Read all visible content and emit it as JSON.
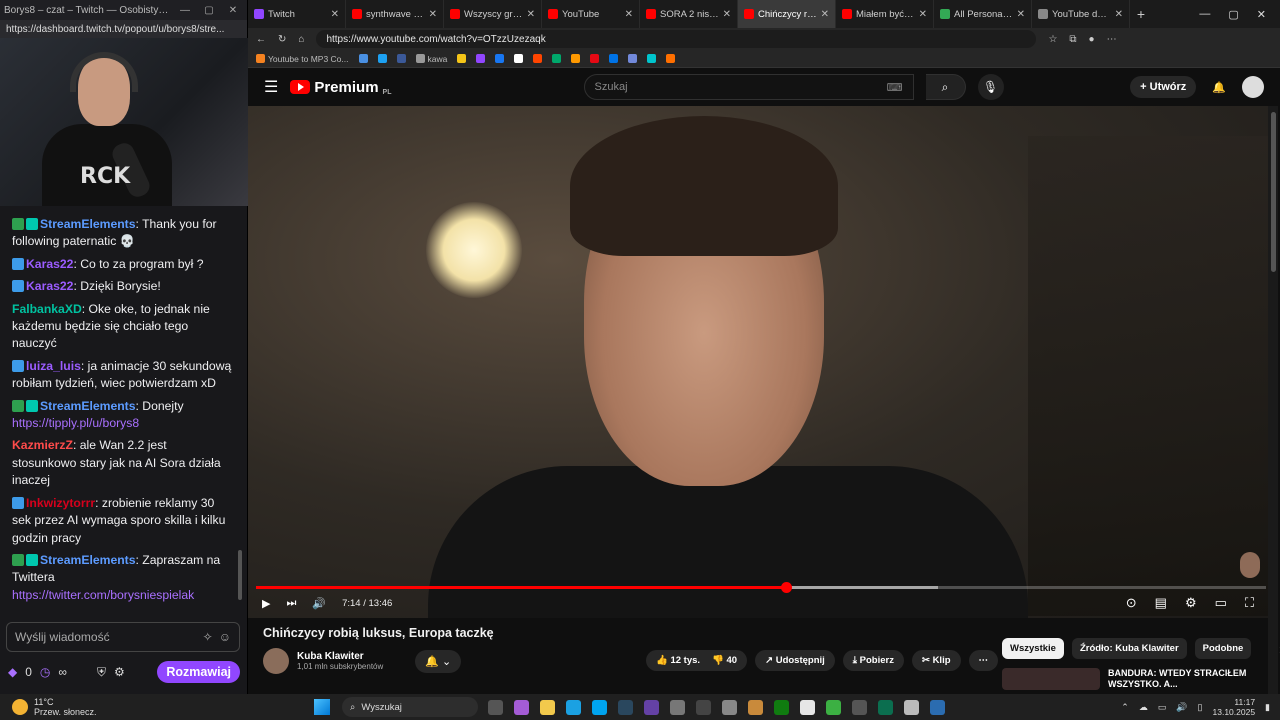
{
  "twitch": {
    "window_title": "Borys8 – czat – Twitch — Osobisty — Mic...",
    "url": "https://dashboard.twitch.tv/popout/u/borys8/stre...",
    "webcam_shirt_text": "RCK",
    "messages": [
      {
        "badges": [
          "b-green",
          "b-teal"
        ],
        "user": "StreamElements",
        "color": "#5c9bff",
        "text": ": Thank you for following paternatic 💀"
      },
      {
        "badges": [
          "b-blue"
        ],
        "user": "Karas22",
        "color": "#9b5cff",
        "text": ": Co to za program był ?"
      },
      {
        "badges": [
          "b-blue"
        ],
        "user": "Karas22",
        "color": "#9b5cff",
        "text": ": Dzięki Borysie!"
      },
      {
        "badges": [],
        "user": "FalbankaXD",
        "color": "#00c2a0",
        "text": ": Oke oke, to jednak nie każdemu będzie się chciało tego nauczyć"
      },
      {
        "badges": [
          "b-blue"
        ],
        "user": "luiza_luis",
        "color": "#9b5cff",
        "text": ": ja animacje 30 sekundową robiłam tydzień, wiec potwierdzam xD"
      },
      {
        "badges": [
          "b-green",
          "b-teal"
        ],
        "user": "StreamElements",
        "color": "#5c9bff",
        "text": ": Donejty",
        "link": "https://tipply.pl/u/borys8"
      },
      {
        "badges": [],
        "user": "KazmierzZ",
        "color": "#ff4b4b",
        "text": ": ale Wan 2.2 jest stosunkowo stary jak na AI Sora działa inaczej"
      },
      {
        "badges": [
          "b-blue"
        ],
        "user": "Inkwizytorrr",
        "color": "#d6001c",
        "text": ": zrobienie reklamy 30 sek przez AI wymaga sporo skilla i kilku godzin pracy"
      },
      {
        "badges": [
          "b-green",
          "b-teal"
        ],
        "user": "StreamElements",
        "color": "#5c9bff",
        "text": ": Zapraszam na Twittera",
        "link": "https://twitter.com/borysniespielak"
      }
    ],
    "input_placeholder": "Wyślij wiadomość",
    "points_count": "0",
    "infinity_symbol": "∞",
    "send_label": "Rozmawiaj"
  },
  "browser": {
    "tabs": [
      {
        "label": "Twitch",
        "color": "#9146ff",
        "active": false
      },
      {
        "label": "synthwave ra...",
        "color": "#ff0000",
        "active": false
      },
      {
        "label": "Wszyscy grają w E...",
        "color": "#ff0000",
        "active": false
      },
      {
        "label": "YouTube",
        "color": "#ff0000",
        "active": false
      },
      {
        "label": "SORA 2 niszczy Int...",
        "color": "#ff0000",
        "active": false
      },
      {
        "label": "Chińczycy robią lu...",
        "color": "#ff0000",
        "active": true
      },
      {
        "label": "Miałem być w USA...",
        "color": "#ff0000",
        "active": false
      },
      {
        "label": "All Personal Feeds",
        "color": "#33aa55",
        "active": false
      },
      {
        "label": "YouTube daje zba...",
        "color": "#888888",
        "active": false
      }
    ],
    "url": "https://www.youtube.com/watch?v=OTzzUzezaqk",
    "bookmarks": [
      {
        "label": "Youtube to MP3 Co...",
        "color": "#f58220"
      },
      {
        "label": "",
        "color": "#4a90e2"
      },
      {
        "label": "",
        "color": "#1da1f2"
      },
      {
        "label": "",
        "color": "#3b5998"
      },
      {
        "label": "kawa",
        "color": "#999999"
      },
      {
        "label": "",
        "color": "#f5c518"
      },
      {
        "label": "",
        "color": "#9146ff"
      },
      {
        "label": "",
        "color": "#1877f2"
      },
      {
        "label": "",
        "color": "#ffffff"
      },
      {
        "label": "",
        "color": "#ff4500"
      },
      {
        "label": "",
        "color": "#00a86b"
      },
      {
        "label": "",
        "color": "#ff9900"
      },
      {
        "label": "",
        "color": "#e50914"
      },
      {
        "label": "",
        "color": "#0073e6"
      },
      {
        "label": "",
        "color": "#7289da"
      },
      {
        "label": "",
        "color": "#00c4cc"
      },
      {
        "label": "",
        "color": "#ff6f00"
      }
    ]
  },
  "youtube": {
    "logo_text": "Premium",
    "logo_region": "PL",
    "search_placeholder": "Szukaj",
    "create_label": "Utwórz",
    "video": {
      "current_time": "7:14",
      "duration": "13:46",
      "played_fraction": 0.525,
      "buffered_fraction": 0.675
    },
    "title": "Chińczycy robią luksus, Europa taczkę",
    "channel_name": "Kuba Klawiter",
    "subscribers": "1,01 mln subskrybentów",
    "likes": "12 tys.",
    "dislikes": "40",
    "share_label": "Udostępnij",
    "download_label": "Pobierz",
    "clip_label": "Klip",
    "chips": [
      "Wszystkie",
      "Źródło: Kuba Klawiter",
      "Podobne"
    ],
    "related_title": "BANDURA: WTEDY STRACIŁEM WSZYSTKO. A..."
  },
  "taskbar": {
    "temperature": "11°C",
    "weather": "Przew. słonecz.",
    "search_label": "Wyszukaj",
    "time": "11:17",
    "date": "13.10.2025"
  }
}
